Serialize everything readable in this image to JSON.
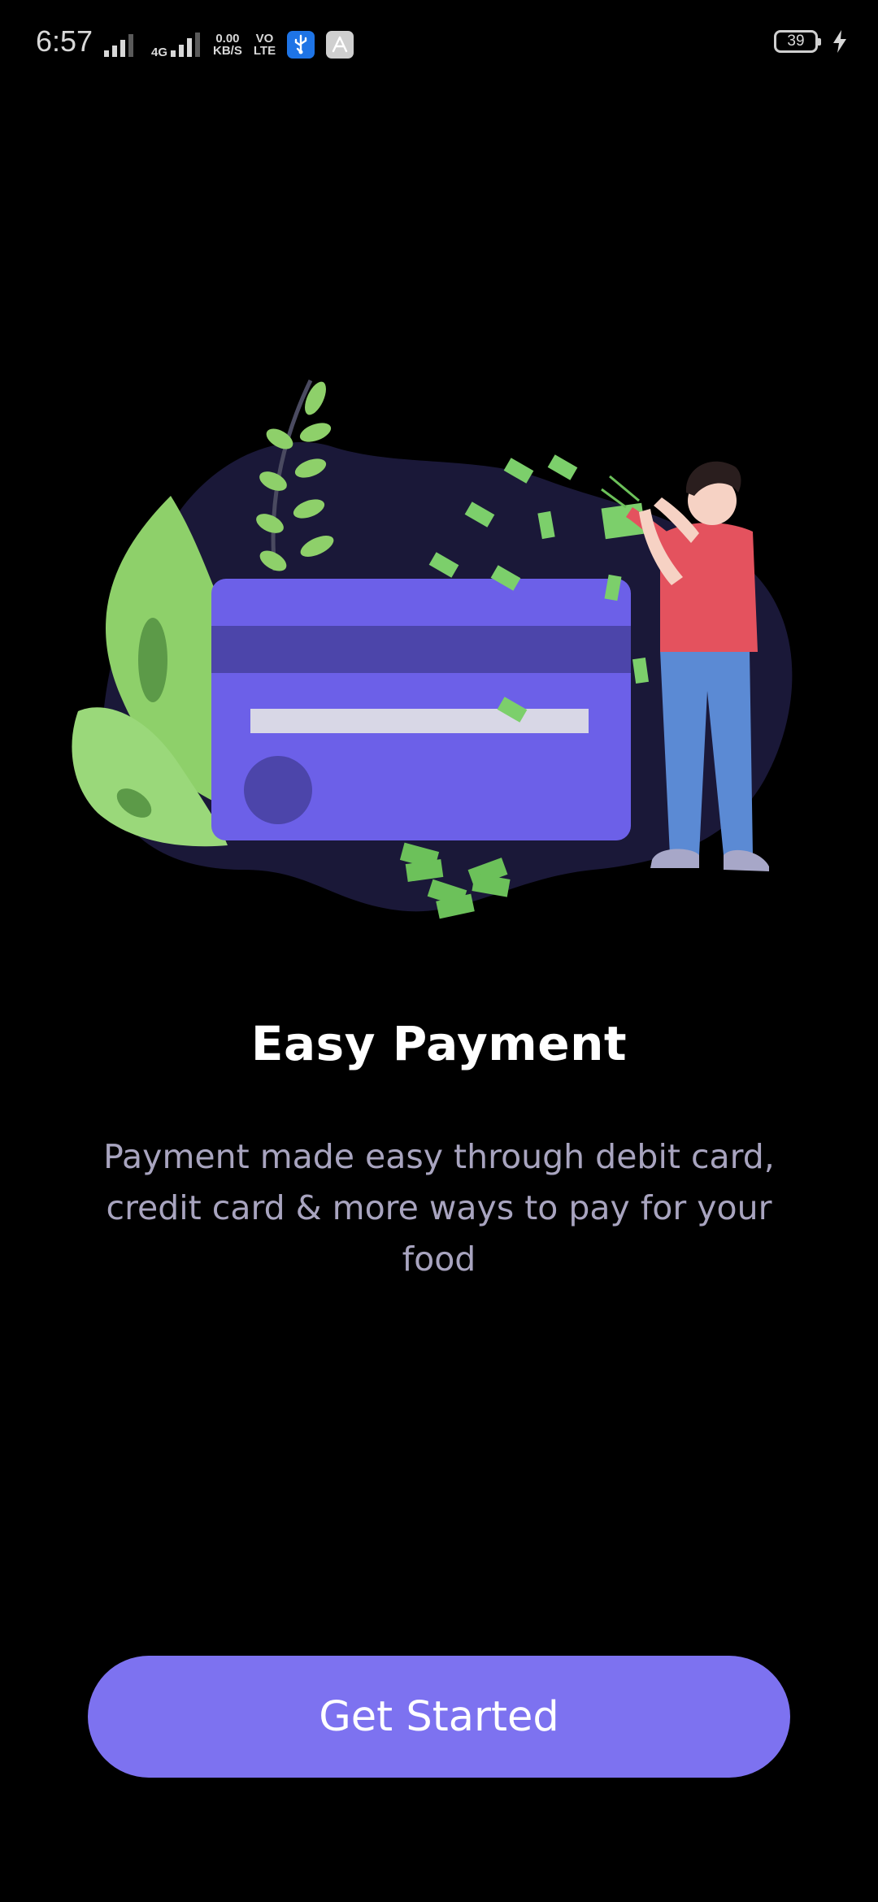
{
  "status_bar": {
    "time": "6:57",
    "network_top": "4G",
    "speed_value": "0.00",
    "speed_unit": "KB/S",
    "volte_top": "VO",
    "volte_bottom": "LTE",
    "battery_level": "39"
  },
  "icons": {
    "signal_1": "signal-bars-icon",
    "signal_2": "signal-bars-4g-icon",
    "usb": "usb-icon",
    "app": "app-store-icon",
    "charging": "lightning-icon"
  },
  "onboarding": {
    "title": "Easy Payment",
    "description": "Payment made easy through debit card,\ncredit card  & more ways to pay for your\nfood",
    "cta_label": "Get Started"
  },
  "colors": {
    "background": "#000000",
    "accent": "#7d72f0",
    "card": "#6c60e8",
    "card_stripe": "#4c45aa",
    "blob": "#1a1838",
    "leaf": "#8ed06a",
    "money": "#7ccf6b",
    "shirt": "#e4525e",
    "jeans": "#5b8ad4",
    "subtitle_text": "#a8a4bf"
  }
}
